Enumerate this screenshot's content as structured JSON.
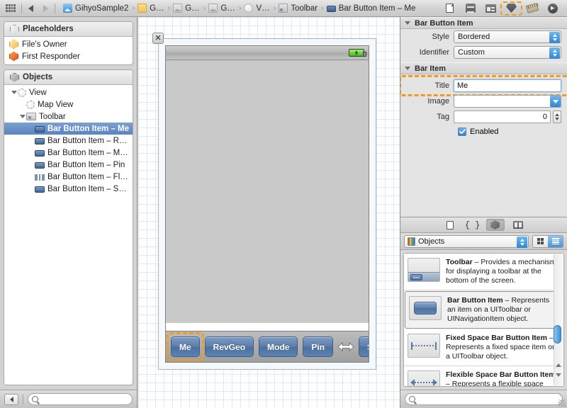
{
  "topbar": {
    "nav": {
      "grid_icon": "grid-view-icon",
      "back_icon": "back-arrow-icon",
      "forward_icon": "forward-arrow-icon"
    },
    "breadcrumbs": [
      {
        "label": "GihyoSample2",
        "icon": "xcode-project-icon"
      },
      {
        "label": "G…",
        "icon": "folder-icon"
      },
      {
        "label": "G…",
        "icon": "image-file-icon"
      },
      {
        "label": "G…",
        "icon": "image-file-icon"
      },
      {
        "label": "V…",
        "icon": "view-icon"
      },
      {
        "label": "Toolbar",
        "icon": "toolbar-icon"
      },
      {
        "label": "Bar Button Item – Me",
        "icon": "bar-button-item-icon"
      }
    ],
    "separator": "›",
    "inspector_tabs": [
      {
        "name": "file-inspector",
        "selected": false
      },
      {
        "name": "quick-help-inspector",
        "selected": false
      },
      {
        "name": "identity-inspector",
        "selected": false
      },
      {
        "name": "attributes-inspector",
        "selected": true
      },
      {
        "name": "size-inspector",
        "selected": false
      },
      {
        "name": "connections-inspector",
        "selected": false
      }
    ]
  },
  "sidebar": {
    "placeholders": {
      "title": "Placeholders",
      "items": [
        {
          "label": "File's Owner",
          "icon": "file-owner-icon"
        },
        {
          "label": "First Responder",
          "icon": "first-responder-icon"
        }
      ]
    },
    "objects": {
      "title": "Objects",
      "tree": [
        {
          "label": "View",
          "indent": 0,
          "icon": "view-icon",
          "disclosure": true,
          "selected": false
        },
        {
          "label": "Map View",
          "indent": 1,
          "icon": "view-icon",
          "disclosure": false,
          "selected": false
        },
        {
          "label": "Toolbar",
          "indent": 1,
          "icon": "toolbar-icon",
          "disclosure": true,
          "selected": false
        },
        {
          "label": "Bar Button Item – Me",
          "indent": 2,
          "icon": "bar-button-item-icon",
          "disclosure": false,
          "selected": true
        },
        {
          "label": "Bar Button Item – R…",
          "indent": 2,
          "icon": "bar-button-item-icon",
          "disclosure": false,
          "selected": false
        },
        {
          "label": "Bar Button Item – M…",
          "indent": 2,
          "icon": "bar-button-item-icon",
          "disclosure": false,
          "selected": false
        },
        {
          "label": "Bar Button Item – Pin",
          "indent": 2,
          "icon": "bar-button-item-icon",
          "disclosure": false,
          "selected": false
        },
        {
          "label": "Bar Button Item – Fl…",
          "indent": 2,
          "icon": "flexible-space-icon",
          "disclosure": false,
          "selected": false
        },
        {
          "label": "Bar Button Item – S…",
          "indent": 2,
          "icon": "bar-button-item-icon",
          "disclosure": false,
          "selected": false
        }
      ]
    },
    "footer": {
      "filter_button_icon": "filter-arrow-icon",
      "search_placeholder": "",
      "search_value": "",
      "search_icon": "search-icon"
    }
  },
  "canvas": {
    "close_button": "✕",
    "status_bar": {
      "battery_icon": "battery-charging-icon"
    },
    "toolbar_buttons": [
      {
        "label": "Me",
        "type": "button",
        "selected": true
      },
      {
        "label": "RevGeo",
        "type": "button",
        "selected": false
      },
      {
        "label": "Mode",
        "type": "button",
        "selected": false
      },
      {
        "label": "Pin",
        "type": "button",
        "selected": false
      },
      {
        "label": "",
        "type": "flexible-space",
        "selected": false
      },
      {
        "label": "Share",
        "type": "button",
        "selected": false
      }
    ]
  },
  "inspector": {
    "sections": [
      {
        "title": "Bar Button Item",
        "rows": [
          {
            "label": "Style",
            "type": "popup",
            "value": "Bordered",
            "name": "style-popup"
          },
          {
            "label": "Identifier",
            "type": "popup",
            "value": "Custom",
            "name": "identifier-popup"
          }
        ]
      },
      {
        "title": "Bar Item",
        "rows": [
          {
            "label": "Title",
            "type": "text",
            "value": "Me",
            "name": "title-field",
            "highlighted": true
          },
          {
            "label": "Image",
            "type": "combo",
            "value": "",
            "name": "image-combo"
          },
          {
            "label": "Tag",
            "type": "number",
            "value": "0",
            "name": "tag-stepper"
          },
          {
            "label": "Enabled",
            "type": "checkbox",
            "value": "Enabled",
            "checked": true,
            "name": "enabled-checkbox"
          }
        ]
      }
    ]
  },
  "library": {
    "tabs": [
      {
        "name": "file-template-library",
        "active": false
      },
      {
        "name": "code-snippet-library",
        "active": false
      },
      {
        "name": "object-library",
        "active": true
      },
      {
        "name": "media-library",
        "active": false
      }
    ],
    "selector": {
      "label": "Objects",
      "icon": "library-color-icon"
    },
    "view_modes": [
      {
        "name": "grid-view-toggle",
        "active": false
      },
      {
        "name": "list-view-toggle",
        "active": true
      }
    ],
    "items": [
      {
        "title": "Toolbar",
        "dash": " – ",
        "desc": "Provides a mechanism for displaying a toolbar at the bottom of the screen.",
        "thumb": "toolbar-thumb",
        "selected": false
      },
      {
        "title": "Bar Button Item",
        "dash": " – ",
        "desc": "Represents an item on a UIToolbar or UINavigationItem object.",
        "thumb": "bar-button-item-thumb",
        "selected": true
      },
      {
        "title": "Fixed Space Bar Button Item",
        "dash": " – ",
        "desc": "Represents a fixed space item on a UIToolbar object.",
        "thumb": "fixed-space-thumb",
        "selected": false
      },
      {
        "title": "Flexible Space Bar Button Item",
        "dash": " – ",
        "desc": "Represents a flexible space item on a UIToolbar object.",
        "thumb": "flexible-space-thumb",
        "selected": false
      }
    ],
    "footer": {
      "search_placeholder": "",
      "search_value": "",
      "search_icon": "search-icon"
    }
  },
  "colors": {
    "selection_ring": "#f09a1e",
    "tree_selection": "#5b84bd",
    "accent_blue": "#2f86d6",
    "toolbar_button": "#5c7fac"
  }
}
